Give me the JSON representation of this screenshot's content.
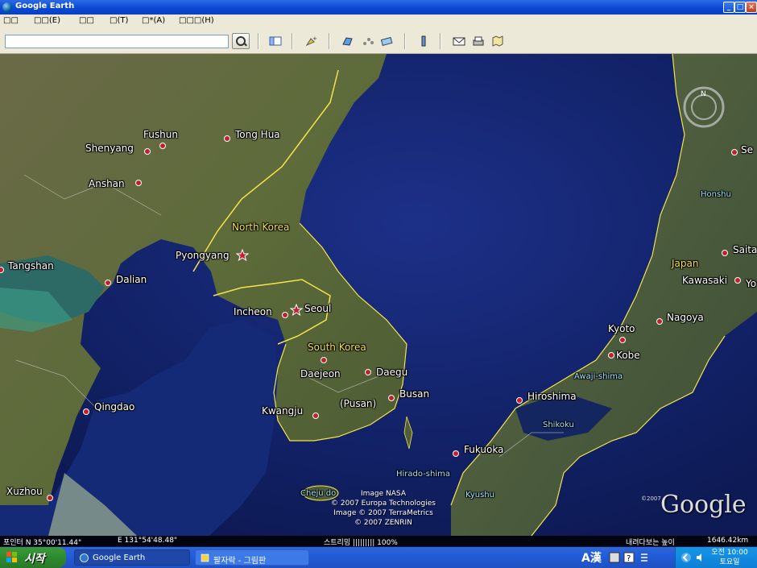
{
  "window": {
    "title": "Google Earth",
    "buttons": [
      "_",
      "□",
      "×"
    ]
  },
  "menu": [
    {
      "label": "□□"
    },
    {
      "label": "□□(E)"
    },
    {
      "label": "□□"
    },
    {
      "label": "□(T)"
    },
    {
      "label": "□*(A)"
    },
    {
      "label": "□□□(H)"
    }
  ],
  "search": {
    "value": "",
    "dropdown_icon": "chevron-down-icon"
  },
  "map": {
    "cities": [
      {
        "name": "Fushun"
      },
      {
        "name": "Shenyang"
      },
      {
        "name": "Tong Hua"
      },
      {
        "name": "Anshan"
      },
      {
        "name": "Tangshan"
      },
      {
        "name": "Dalian"
      },
      {
        "name": "Pyongyang"
      },
      {
        "name": "Incheon"
      },
      {
        "name": "Seoul"
      },
      {
        "name": "Daejeon"
      },
      {
        "name": "Daegu"
      },
      {
        "name": "Busan"
      },
      {
        "name": "(Pusan)"
      },
      {
        "name": "Kwangju"
      },
      {
        "name": "Qingdao"
      },
      {
        "name": "Xuzhou"
      },
      {
        "name": "Hiroshima"
      },
      {
        "name": "Fukuoka"
      },
      {
        "name": "Kyoto"
      },
      {
        "name": "Kobe"
      },
      {
        "name": "Nagoya"
      },
      {
        "name": "Kawasaki"
      },
      {
        "name": "Saita"
      },
      {
        "name": "Se"
      },
      {
        "name": "Yo"
      }
    ],
    "countries": [
      {
        "name": "North Korea"
      },
      {
        "name": "South Korea"
      },
      {
        "name": "Japan"
      }
    ],
    "islands": [
      {
        "name": "Honshu"
      },
      {
        "name": "Awaji-shima"
      },
      {
        "name": "Shikoku"
      },
      {
        "name": "Kyushu"
      },
      {
        "name": "Hirado-shima"
      },
      {
        "name": "Cheju do"
      }
    ],
    "credits": [
      "Image NASA",
      "© 2007 Europa Technologies",
      "Image © 2007 TerraMetrics",
      "© 2007 ZENRIN"
    ],
    "logo": "Google",
    "logo_copyright": "©2007"
  },
  "status": {
    "pointer": "포인터 N 35°00'11.44\"",
    "lon": "E 131°54'48.48\"",
    "streaming": "스트리밍 ||||||||| 100%",
    "eye_alt_label": "내려다보는 높이",
    "eye_alt_value": "1646.42km"
  },
  "taskbar": {
    "start": "시작",
    "tasks": [
      {
        "label": "Google Earth"
      },
      {
        "label": "팔자락 - 그림판"
      }
    ],
    "ime": "A漢",
    "clock_line1": "오전 10:00",
    "clock_line2": "토요일"
  },
  "colors": {
    "title_bar": "#0b48d6",
    "taskbar": "#245edb",
    "start_button": "#2f8a2f",
    "city_dot": "#c0202a",
    "border_yellow": "#f5e34a",
    "sea": "#14246a"
  }
}
